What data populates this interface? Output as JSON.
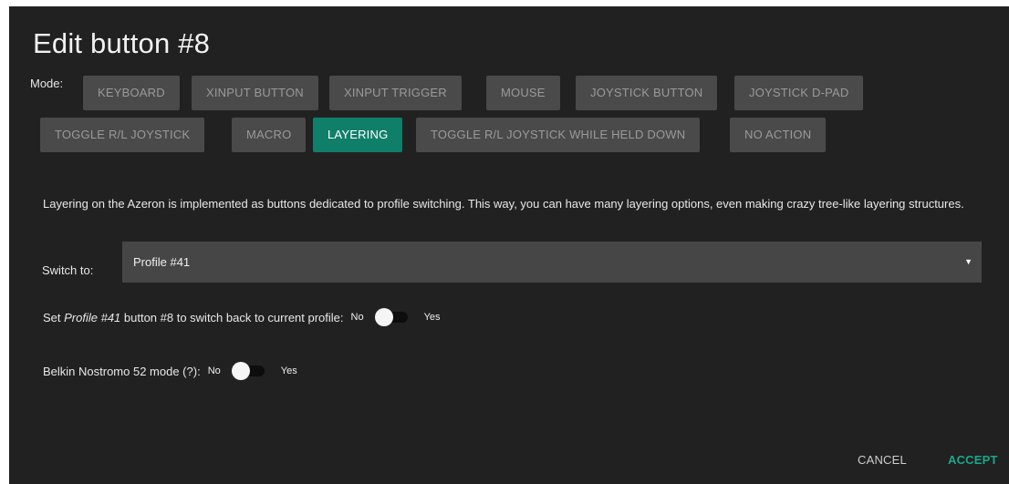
{
  "dialog": {
    "title": "Edit button #8",
    "mode_label": "Mode:",
    "modes": [
      {
        "label": "KEYBOARD",
        "active": false
      },
      {
        "label": "XINPUT BUTTON",
        "active": false
      },
      {
        "label": "XINPUT TRIGGER",
        "active": false
      },
      {
        "label": "MOUSE",
        "active": false
      },
      {
        "label": "JOYSTICK BUTTON",
        "active": false
      },
      {
        "label": "JOYSTICK D-PAD",
        "active": false
      },
      {
        "label": "TOGGLE R/L JOYSTICK",
        "active": false
      },
      {
        "label": "MACRO",
        "active": false
      },
      {
        "label": "LAYERING",
        "active": true
      },
      {
        "label": "TOGGLE R/L JOYSTICK WHILE HELD DOWN",
        "active": false
      },
      {
        "label": "NO ACTION",
        "active": false
      }
    ],
    "description": "Layering on the Azeron is implemented as buttons dedicated to profile switching. This way, you can have many layering options, even making crazy tree-like layering structures.",
    "switch_to": {
      "label": "Switch to:",
      "selected": "Profile #41",
      "caret": "▼"
    },
    "switch_back": {
      "prefix": "Set ",
      "profile": "Profile #41",
      "suffix": " button #8 to switch back to current profile:",
      "off_label": "No",
      "on_label": "Yes",
      "value": false
    },
    "nostromo": {
      "label": "Belkin Nostromo 52 mode (?):",
      "off_label": "No",
      "on_label": "Yes",
      "value": false
    },
    "footer": {
      "cancel": "CANCEL",
      "accept": "ACCEPT"
    }
  },
  "colors": {
    "background": "#212121",
    "button": "#4a4a4a",
    "button_active": "#0f7f69",
    "accent": "#1aa88a"
  }
}
